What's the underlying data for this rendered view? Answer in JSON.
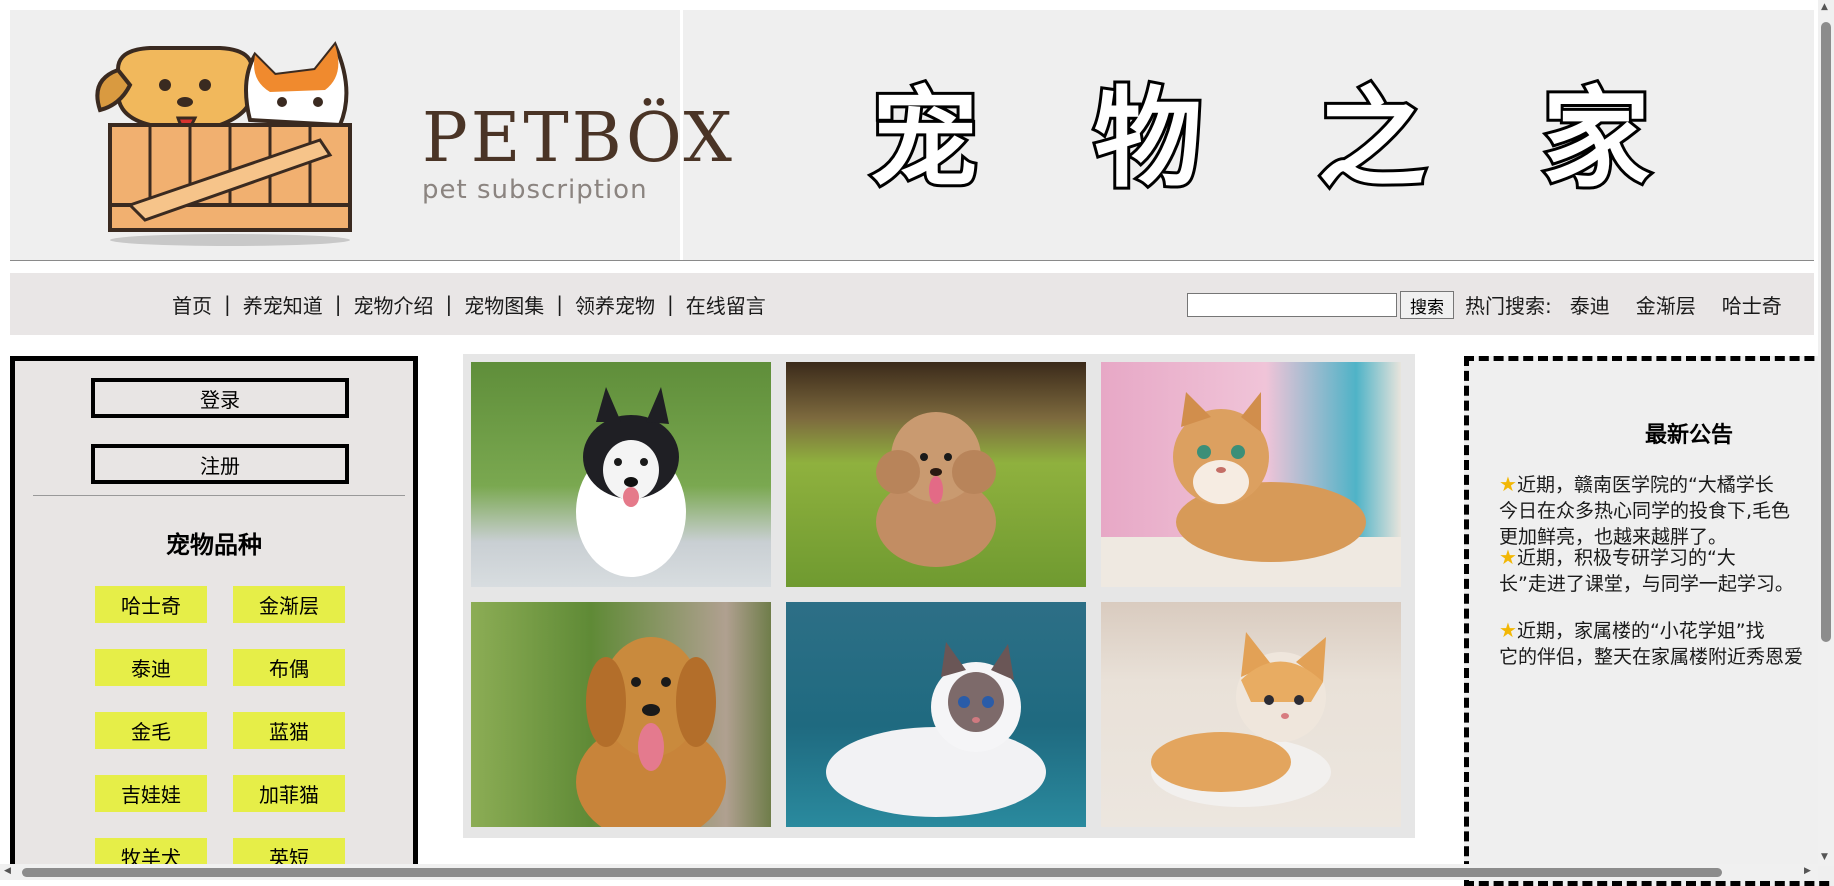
{
  "header": {
    "logo_text": "PETBÖX",
    "logo_sub": "pet subscription",
    "title_chars": [
      "宠",
      "物",
      "之",
      "家"
    ]
  },
  "nav": {
    "links": [
      "首页",
      "养宠知道",
      "宠物介绍",
      "宠物图集",
      "领养宠物",
      "在线留言"
    ],
    "search_button": "搜索",
    "hot_label": "热门搜索:",
    "hot_items": [
      "泰迪",
      "金渐层",
      "哈士奇"
    ]
  },
  "sidebar": {
    "login": "登录",
    "register": "注册",
    "breed_title": "宠物品种",
    "breeds": [
      "哈士奇",
      "金渐层",
      "泰迪",
      "布偶",
      "金毛",
      "蓝猫",
      "吉娃娃",
      "加菲猫",
      "牧羊犬",
      "英短"
    ]
  },
  "notices": {
    "title": "最新公告",
    "items": [
      {
        "line1": "近期，赣南医学院的“大橘学长",
        "line2": "今日在众多热心同学的投食下,毛色",
        "line3": "更加鲜亮，也越来越胖了。"
      },
      {
        "line1": "近期，积极专研学习的“大",
        "line2": "长”走进了课堂，与同学一起学习。"
      },
      {
        "line1": "近期，家属楼的“小花学姐”找",
        "line2": "它的伴侣，整天在家属楼附近秀恩爱"
      }
    ]
  },
  "photos": [
    {
      "name": "husky-puppy-photo",
      "bg": "#6f9a45"
    },
    {
      "name": "poodle-photo",
      "bg": "#6d9a36"
    },
    {
      "name": "golden-cat-photo",
      "bg": "#e8a9c4"
    },
    {
      "name": "golden-retriever-photo",
      "bg": "#7a9a48"
    },
    {
      "name": "ragdoll-cat-photo",
      "bg": "#2b7a90"
    },
    {
      "name": "orange-kitten-photo",
      "bg": "#e3d9cf"
    }
  ],
  "colors": {
    "breed_bg": "#e6ee48",
    "header_bg": "#efefef",
    "nav_bg": "#e9e6e6"
  }
}
